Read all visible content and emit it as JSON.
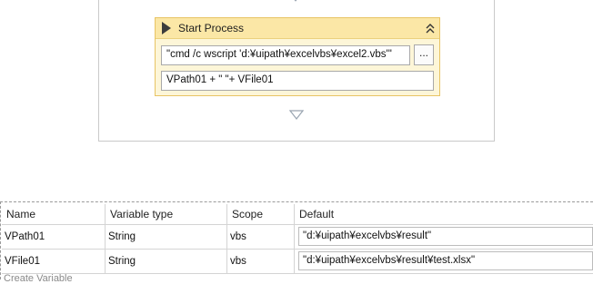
{
  "activity": {
    "title": "Start Process",
    "icon": "play-icon",
    "collapse_icon": "double-chevron-up-icon",
    "arguments_value": "\"cmd /c wscript   'd:¥uipath¥excelvbs¥excel2.vbs'\"",
    "browse_label": "...",
    "path_value": "VPath01 + \" \"+ VFile01",
    "header_color": "#fbe7a6",
    "body_color": "#fdf6d8",
    "border_color": "#e8c465"
  },
  "variables": {
    "headers": [
      "Name",
      "Variable type",
      "Scope",
      "Default"
    ],
    "rows": [
      {
        "name": "VPath01",
        "type": "String",
        "scope": "vbs",
        "default": "\"d:¥uipath¥excelvbs¥result\""
      },
      {
        "name": "VFile01",
        "type": "String",
        "scope": "vbs",
        "default": "\"d:¥uipath¥excelvbs¥result¥test.xlsx\""
      }
    ],
    "create_label": "Create Variable"
  }
}
